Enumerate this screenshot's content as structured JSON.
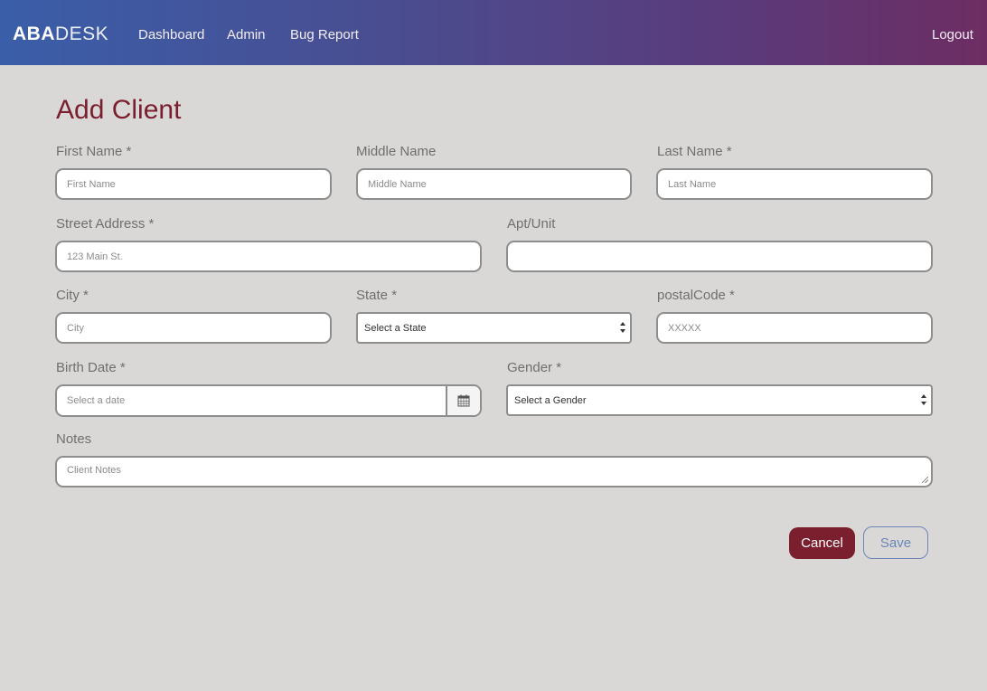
{
  "app": {
    "brand_bold": "ABA",
    "brand_light": "DESK"
  },
  "nav": {
    "items": [
      "Dashboard",
      "Admin",
      "Bug Report"
    ],
    "logout": "Logout"
  },
  "page": {
    "title": "Add Client"
  },
  "form": {
    "first_name": {
      "label": "First Name *",
      "placeholder": "First Name"
    },
    "middle_name": {
      "label": "Middle Name",
      "placeholder": "Middle Name"
    },
    "last_name": {
      "label": "Last Name *",
      "placeholder": "Last Name"
    },
    "street": {
      "label": "Street Address *",
      "placeholder": "123 Main St."
    },
    "apt": {
      "label": "Apt/Unit",
      "placeholder": ""
    },
    "city": {
      "label": "City *",
      "placeholder": "City"
    },
    "state": {
      "label": "State *",
      "selected": "Select a State"
    },
    "postal": {
      "label": "postalCode *",
      "placeholder": "XXXXX"
    },
    "birth_date": {
      "label": "Birth Date *",
      "placeholder": "Select a date"
    },
    "gender": {
      "label": "Gender *",
      "selected": "Select a Gender"
    },
    "notes": {
      "label": "Notes",
      "placeholder": "Client Notes"
    }
  },
  "actions": {
    "cancel": "Cancel",
    "save": "Save"
  },
  "icons": {
    "calendar": "calendar-icon",
    "select_arrows": "select-arrows-icon"
  },
  "colors": {
    "title": "#7b1f2e",
    "cancel_bg": "#7b1f2e",
    "save_outline": "#6b86b8",
    "navbar_start": "#3a5ea9",
    "navbar_end": "#6d2d62",
    "page_bg": "#d9d8d7"
  }
}
